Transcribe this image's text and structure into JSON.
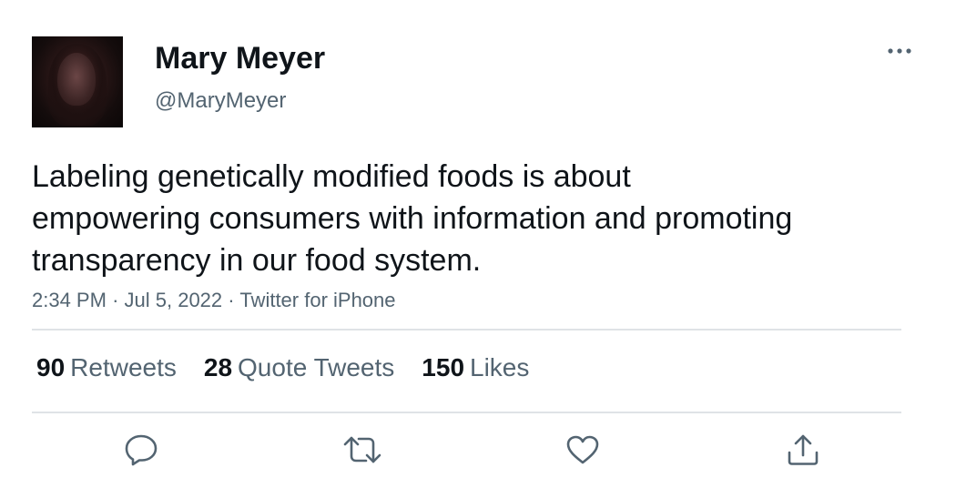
{
  "author": {
    "display_name": "Mary Meyer",
    "handle": "@MaryMeyer"
  },
  "tweet": {
    "text": "Labeling genetically modified foods is about\nempowering consumers with information and promoting\ntransparency in our food system.",
    "time": "2:34 PM",
    "date": "Jul 5, 2022",
    "source": "Twitter for iPhone",
    "separator": "·"
  },
  "stats": {
    "retweets_count": "90",
    "retweets_label": "Retweets",
    "quotes_count": "28",
    "quotes_label": "Quote Tweets",
    "likes_count": "150",
    "likes_label": "Likes"
  },
  "icons": {
    "more": "more-horizontal-icon",
    "reply": "reply-icon",
    "retweet": "retweet-icon",
    "like": "heart-icon",
    "share": "share-icon"
  },
  "colors": {
    "text_primary": "#0f1419",
    "text_secondary": "#536471",
    "divider": "#dfe3e6"
  }
}
